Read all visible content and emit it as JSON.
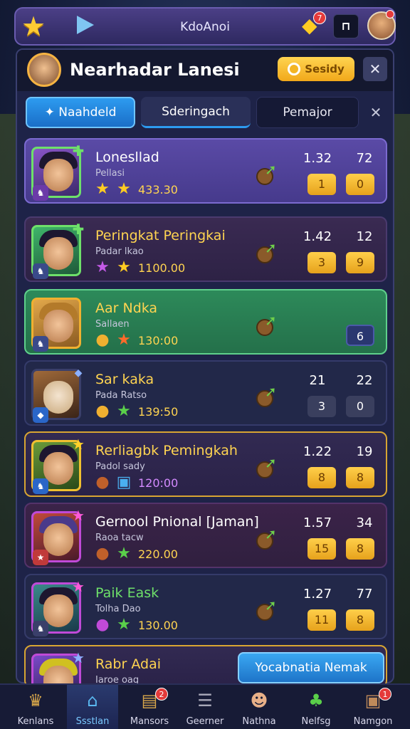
{
  "top_bar": {
    "title": "KdoAnoi",
    "star_icon": "star-icon",
    "gem_badge": "7"
  },
  "header": {
    "title": "Nearhadar Lanesi",
    "button_label": "Sesidy"
  },
  "tabs": [
    {
      "label": "Naahdeld"
    },
    {
      "label": "Sderingach"
    },
    {
      "label": "Pemajor"
    }
  ],
  "rows": [
    {
      "name": "Lonesllad",
      "sub": "Pellasi",
      "score": "433.30",
      "n1": "1.32",
      "n2": "72",
      "c1": "1",
      "c2": "0"
    },
    {
      "name": "Peringkat Peringkai",
      "sub": "Padar lkao",
      "score": "1100.00",
      "n1": "1.42",
      "n2": "12",
      "c1": "3",
      "c2": "9"
    },
    {
      "name": "Aar Ndka",
      "sub": "Sallaen",
      "score": "130:00",
      "n1": "",
      "n2": "",
      "c1": "",
      "c2": "6"
    },
    {
      "name": "Sar kaka",
      "sub": "Pada Ratso",
      "score": "139:50",
      "n1": "21",
      "n2": "22",
      "c1": "3",
      "c2": "0"
    },
    {
      "name": "Rerliagbk Pemingkah",
      "sub": "Padol sady",
      "score": "120:00",
      "n1": "1.22",
      "n2": "19",
      "c1": "8",
      "c2": "8"
    },
    {
      "name": "Gernool Pnional [Jaman]",
      "sub": "Raoa tacw",
      "score": "220.00",
      "n1": "1.57",
      "n2": "34",
      "c1": "15",
      "c2": "8"
    },
    {
      "name": "Paik Eask",
      "sub": "Tolha Dao",
      "score": "130.00",
      "n1": "1.27",
      "n2": "77",
      "c1": "11",
      "c2": "8"
    },
    {
      "name": "Rabr Adai",
      "sub": "Iaroe oag",
      "cta": "Yocabnatia Nemak"
    }
  ],
  "bottom_nav": [
    {
      "label": "Kenlans",
      "icon": "trophy-icon"
    },
    {
      "label": "Ssstlan",
      "icon": "home-icon"
    },
    {
      "label": "Mansors",
      "icon": "shop-icon",
      "badge": "2"
    },
    {
      "label": "Geerner",
      "icon": "stack-icon"
    },
    {
      "label": "Nathna",
      "icon": "character-icon"
    },
    {
      "label": "Nelfsg",
      "icon": "clover-icon"
    },
    {
      "label": "Namgon",
      "icon": "chest-icon",
      "badge": "1"
    }
  ]
}
